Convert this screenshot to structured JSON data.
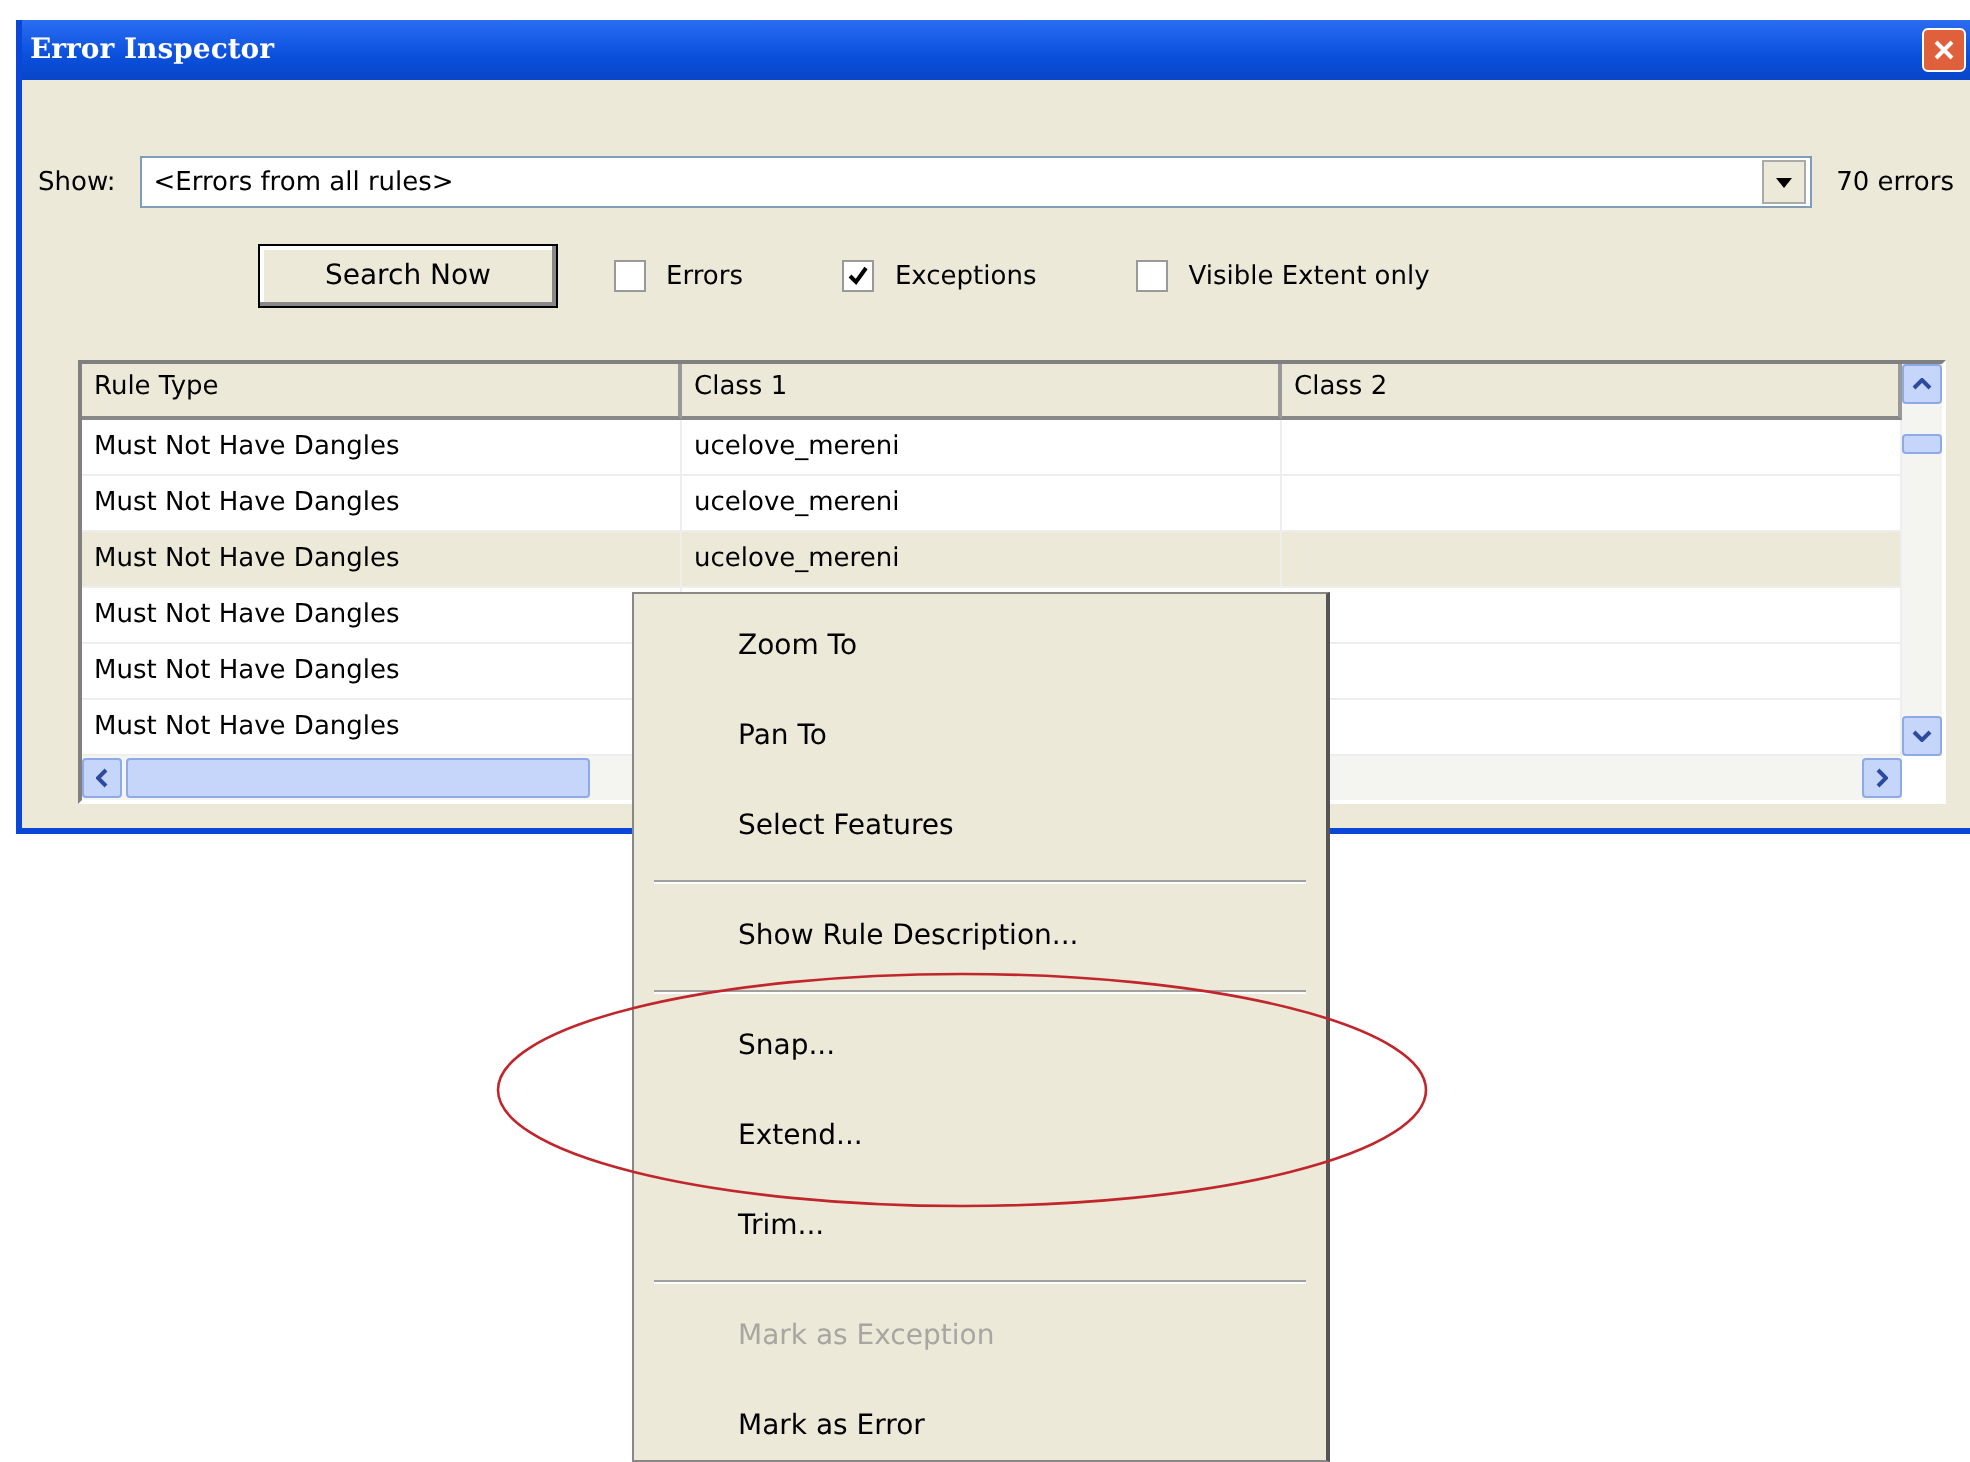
{
  "window": {
    "title": "Error Inspector"
  },
  "show": {
    "label": "Show:",
    "value": "<Errors from all rules>",
    "count": "70 errors"
  },
  "search_button": "Search Now",
  "filters": [
    {
      "label": "Errors",
      "checked": false
    },
    {
      "label": "Exceptions",
      "checked": true
    },
    {
      "label": "Visible Extent only",
      "checked": false
    }
  ],
  "table": {
    "columns": [
      "Rule Type",
      "Class 1",
      "Class 2"
    ],
    "rows": [
      {
        "cells": [
          "Must Not Have Dangles",
          "ucelove_mereni"
        ],
        "selected": false
      },
      {
        "cells": [
          "Must Not Have Dangles",
          "ucelove_mereni"
        ],
        "selected": false
      },
      {
        "cells": [
          "Must Not Have Dangles",
          "ucelove_mereni"
        ],
        "selected": true
      },
      {
        "cells": [
          "Must Not Have Dangles"
        ],
        "selected": false
      },
      {
        "cells": [
          "Must Not Have Dangles"
        ],
        "selected": false
      },
      {
        "cells": [
          "Must Not Have Dangles"
        ],
        "selected": false
      }
    ]
  },
  "context_menu": [
    {
      "kind": "item",
      "label": "Zoom To",
      "disabled": false
    },
    {
      "kind": "item",
      "label": "Pan To",
      "disabled": false
    },
    {
      "kind": "item",
      "label": "Select Features",
      "disabled": false
    },
    {
      "kind": "separator"
    },
    {
      "kind": "item",
      "label": "Show Rule Description...",
      "disabled": false
    },
    {
      "kind": "separator"
    },
    {
      "kind": "item",
      "label": "Snap...",
      "disabled": false
    },
    {
      "kind": "item",
      "label": "Extend...",
      "disabled": false
    },
    {
      "kind": "item",
      "label": "Trim...",
      "disabled": false
    },
    {
      "kind": "separator"
    },
    {
      "kind": "item",
      "label": "Mark as Exception",
      "disabled": true
    },
    {
      "kind": "item",
      "label": "Mark as Error",
      "disabled": false
    }
  ]
}
